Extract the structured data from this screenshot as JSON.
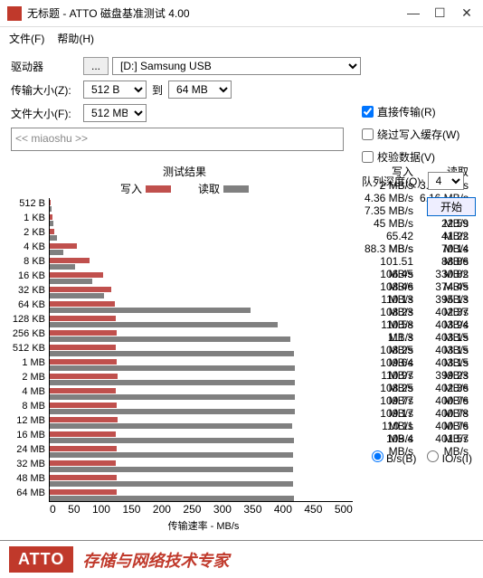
{
  "window": {
    "title": "无标题 - ATTO 磁盘基准测试 4.00"
  },
  "menu": {
    "file": "文件(F)",
    "help": "帮助(H)"
  },
  "labels": {
    "drive": "驱动器",
    "transferSize": "传输大小(Z):",
    "to": "到",
    "fileSize": "文件大小(F):",
    "browse": "..."
  },
  "fields": {
    "drive": "[D:] Samsung USB",
    "sizeFrom": "512 B",
    "sizeTo": "64 MB",
    "fileSize": "512 MB"
  },
  "opts": {
    "direct": "直接传输(R)",
    "bypass": "绕过写入缓存(W)",
    "verify": "校验数据(V)",
    "queue": "队列深度(Q):",
    "queueVal": "4",
    "start": "开始"
  },
  "desc": "<< miaoshu >>",
  "res": {
    "title": "测试结果",
    "write": "写入",
    "read": "读取",
    "xlabel": "传输速率 - MB/s",
    "bs": "B/s(B)",
    "ios": "IO/s(I)"
  },
  "xticks": [
    "0",
    "50",
    "100",
    "150",
    "200",
    "250",
    "300",
    "350",
    "400",
    "450",
    "500"
  ],
  "chart_data": {
    "type": "bar",
    "xlim": [
      0,
      500
    ],
    "xlabel": "传输速率 - MB/s",
    "categories": [
      "512 B",
      "1 KB",
      "2 KB",
      "4 KB",
      "8 KB",
      "16 KB",
      "32 KB",
      "64 KB",
      "128 KB",
      "256 KB",
      "512 KB",
      "1 MB",
      "2 MB",
      "4 MB",
      "8 MB",
      "12 MB",
      "16 MB",
      "24 MB",
      "32 MB",
      "48 MB",
      "64 MB"
    ],
    "series": [
      {
        "name": "写入",
        "values": [
          2,
          4.36,
          7.35,
          45,
          65.42,
          88.3,
          101.51,
          106.45,
          108.46,
          110.13,
          108.23,
          110.58,
          111.3,
          108.25,
          109.64,
          110.97,
          108.25,
          109.77,
          109.17,
          110.11,
          109.4
        ]
      },
      {
        "name": "读取",
        "values": [
          3.13,
          6.16,
          11.91,
          22.59,
          41.22,
          70.14,
          88.86,
          330.82,
          374.45,
          395.13,
          402.37,
          403.94,
          403.15,
          403.15,
          403.15,
          399.23,
          402.36,
          400.76,
          400.78,
          400.76,
          401.57
        ]
      }
    ]
  },
  "footer": {
    "logo": "ATTO",
    "text": "存储与网络技术专家"
  }
}
